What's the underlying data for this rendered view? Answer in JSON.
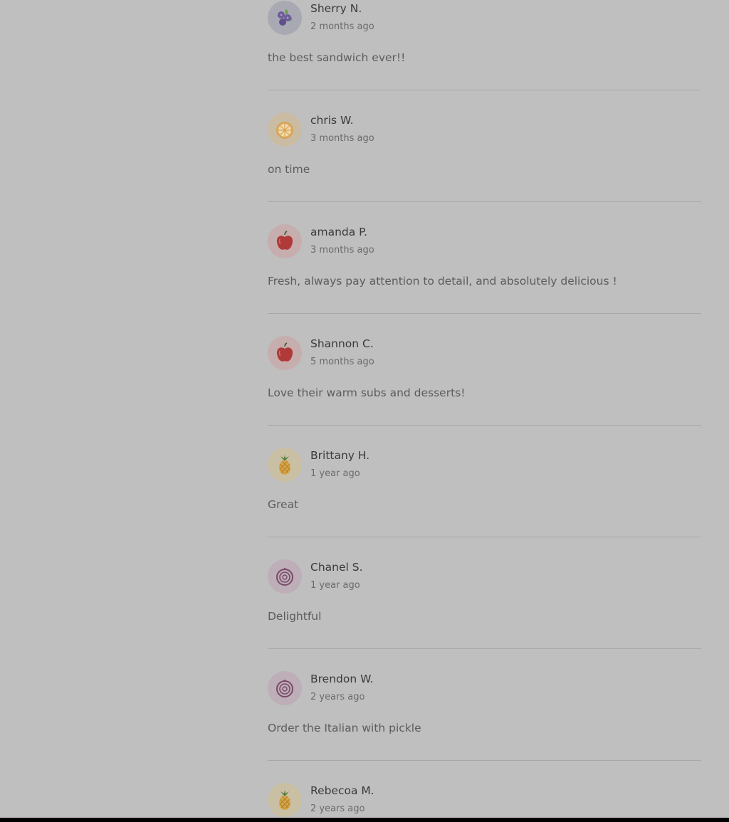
{
  "reviews": [
    {
      "name": "Sherry N.",
      "time": "2 months ago",
      "text": "the best sandwich ever!!",
      "avatar": "blueberry-icon"
    },
    {
      "name": "chris W.",
      "time": "3 months ago",
      "text": "on time",
      "avatar": "orange-icon"
    },
    {
      "name": "amanda P.",
      "time": "3 months ago",
      "text": "Fresh, always pay attention to detail, and absolutely delicious !",
      "avatar": "apple-icon"
    },
    {
      "name": "Shannon C.",
      "time": "5 months ago",
      "text": "Love their warm subs and desserts!",
      "avatar": "apple-icon"
    },
    {
      "name": "Brittany H.",
      "time": "1 year ago",
      "text": "Great",
      "avatar": "pineapple-icon"
    },
    {
      "name": "Chanel S.",
      "time": "1 year ago",
      "text": "Delightful",
      "avatar": "onion-icon"
    },
    {
      "name": "Brendon W.",
      "time": "2 years ago",
      "text": "Order the Italian with pickle",
      "avatar": "onion-icon"
    },
    {
      "name": "Rebecoa M.",
      "time": "2 years ago",
      "text": "",
      "avatar": "pineapple-icon"
    }
  ],
  "colors": {
    "background": "#bfbfbf",
    "name": "#3a3a3a",
    "time": "#6a6a6a",
    "text": "#5c5c5c",
    "divider": "#a8a8a8"
  }
}
